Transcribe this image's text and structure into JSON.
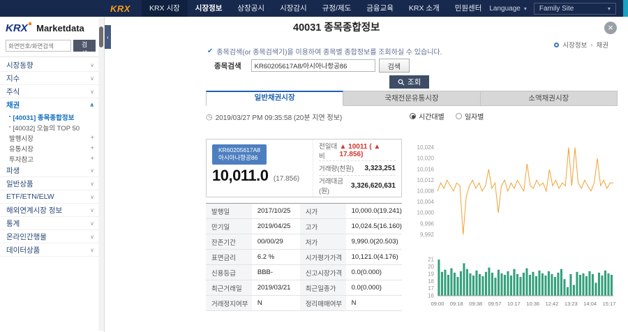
{
  "topnav": {
    "logo": "KRX",
    "items": [
      "KRX 시장",
      "시장정보",
      "상장공시",
      "시장감시",
      "규정/제도",
      "금융교육",
      "KRX 소개",
      "민원센터"
    ],
    "language": "Language",
    "family_site": "Family Site"
  },
  "sidebar": {
    "logo_krx": "KRX",
    "logo_marketdata": "Marketdata",
    "search_placeholder": "화면번호/화면검색",
    "search_button": "검색",
    "menu": [
      {
        "label": "시장동향"
      },
      {
        "label": "지수"
      },
      {
        "label": "주식"
      },
      {
        "label": "채권"
      },
      {
        "label": "[40031] 종목종합정보"
      },
      {
        "label": "[40032] 오늘의 TOP 50"
      },
      {
        "label": "발행시장"
      },
      {
        "label": "유통시장"
      },
      {
        "label": "투자참고"
      },
      {
        "label": "파생"
      },
      {
        "label": "일반상품"
      },
      {
        "label": "ETF/ETN/ELW"
      },
      {
        "label": "해외연계시장 정보"
      },
      {
        "label": "통계"
      },
      {
        "label": "온라인간행물"
      },
      {
        "label": "데이터상품"
      }
    ]
  },
  "content": {
    "title": "40031 종목종합정보",
    "breadcrumb": {
      "section": "시장정보",
      "page": "채권"
    },
    "notice": "종목검색(or 종목검색기)을 이용하여 종목별 종합정보를 조회하실 수 있습니다.",
    "search_form": {
      "label": "종목검색",
      "value": "KR60205617A8/아시아나항공86",
      "search_button": "검색",
      "submit_button": "조회"
    },
    "tabs": [
      {
        "label": "일반채권시장",
        "active": true
      },
      {
        "label": "국채전문유통시장",
        "active": false
      },
      {
        "label": "소액채권시장",
        "active": false
      }
    ],
    "timestamp": "2019/03/27 PM 09:35:58 (20분 지연 정보)",
    "view_options": [
      {
        "label": "시간대별",
        "selected": true
      },
      {
        "label": "일자별",
        "selected": false
      }
    ],
    "quote": {
      "isin": "KR60205617A8",
      "name": "아시아나항공86",
      "price": "10,011.0",
      "yield": "(17.856)",
      "change_label": "전일대비",
      "change_value": "▲ 10011 ( ▲ 17.856)",
      "volume_label": "거래량(천원)",
      "volume_value": "3,323,251",
      "amount_label": "거래대금(원)",
      "amount_value": "3,326,620,631"
    },
    "details": [
      [
        {
          "label": "발행일",
          "value": "2017/10/25"
        },
        {
          "label": "시가",
          "value": "10,000.0(19.241)"
        }
      ],
      [
        {
          "label": "만기일",
          "value": "2019/04/25"
        },
        {
          "label": "고가",
          "value": "10,024.5(16.160)"
        }
      ],
      [
        {
          "label": "잔존기간",
          "value": "00/00/29"
        },
        {
          "label": "저가",
          "value": "9,990.0(20.503)"
        }
      ],
      [
        {
          "label": "표면금리",
          "value": "6.2 %"
        },
        {
          "label": "시가평가가격",
          "value": "10,121.0(4.176)"
        }
      ],
      [
        {
          "label": "신용등급",
          "value": "BBB-"
        },
        {
          "label": "신고시장가격",
          "value": "0.0(0.000)"
        }
      ],
      [
        {
          "label": "최근거래일",
          "value": "2019/03/21"
        },
        {
          "label": "최근일종가",
          "value": "0.0(0.000)"
        }
      ],
      [
        {
          "label": "거래정지여부",
          "value": "N"
        },
        {
          "label": "정리매매여부",
          "value": "N"
        }
      ]
    ]
  },
  "colors": {
    "accent": "#2e6db4",
    "navy": "#17294d",
    "up_red": "#d6342c"
  },
  "chart_data": [
    {
      "type": "line",
      "title": "",
      "xlabel": "",
      "ylabel": "",
      "color": "#f0a232",
      "ylim": [
        9988,
        10028
      ],
      "yticks": [
        9992,
        9996,
        10000,
        10004,
        10008,
        10012,
        10016,
        10020,
        10024
      ],
      "values": [
        10008,
        10011,
        10009,
        10012,
        10010,
        10008,
        10011,
        10010,
        9992,
        10006,
        10010,
        10012,
        10009,
        10011,
        10008,
        10010,
        10016,
        10009,
        10011,
        10000,
        10010,
        10012,
        10008,
        10011,
        10009,
        10012,
        10010,
        10008,
        10018,
        10010,
        10009,
        10012,
        10010,
        10011,
        10008,
        10016,
        10010,
        10012,
        10009,
        10011,
        10010,
        10024,
        10010,
        10024,
        10011,
        10009,
        10012,
        10010,
        10008,
        10011,
        10020,
        10010,
        10012,
        10009,
        10011,
        10011
      ]
    },
    {
      "type": "bar",
      "title": "",
      "xlabel": "",
      "ylabel": "",
      "color": "#35a17b",
      "ylim": [
        16,
        21.6
      ],
      "yticks": [
        16,
        17,
        18,
        19,
        20,
        21
      ],
      "x_labels": [
        "09:00",
        "09:18",
        "09:38",
        "09:57",
        "10:17",
        "10:36",
        "12:42",
        "13:23",
        "14:04",
        "15:17"
      ],
      "values": [
        21,
        19.3,
        19.6,
        18.9,
        19.8,
        19.2,
        18.6,
        19.4,
        20.5,
        19.7,
        19.1,
        18.8,
        19.5,
        19.0,
        18.7,
        19.3,
        19.9,
        19.2,
        18.5,
        19.6,
        19.1,
        18.9,
        19.4,
        18.8,
        19.7,
        19.0,
        18.6,
        19.2,
        19.8,
        18.9,
        19.3,
        18.7,
        19.5,
        19.1,
        18.8,
        19.4,
        19.0,
        18.6,
        19.2,
        19.7,
        18.3,
        17.2,
        19.0,
        17.5,
        19.3,
        18.9,
        19.1,
        18.7,
        19.4,
        19.0,
        17.8,
        19.2,
        18.8,
        19.5,
        19.1,
        18.9
      ]
    }
  ]
}
